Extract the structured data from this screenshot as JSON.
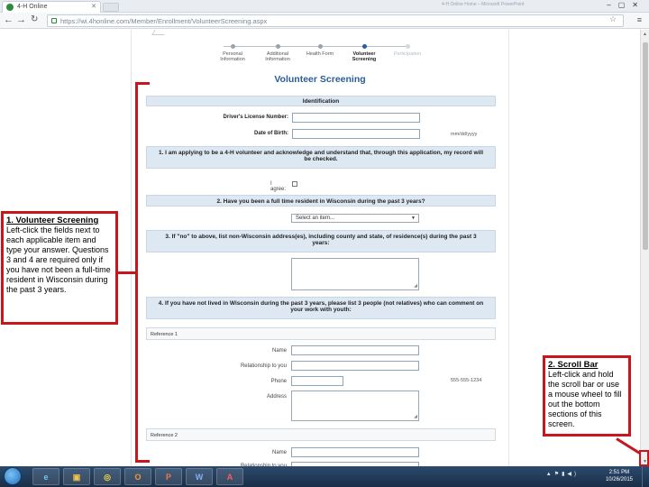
{
  "browser": {
    "tab_title": "4-H Online",
    "tab_ghost_title": "4-H Online Home – Microsoft PowerPoint",
    "url": "https://wi.4honline.com/Member/Enrollment/VolunteerScreening.aspx"
  },
  "wizard": {
    "steps": [
      {
        "label": "Personal Information"
      },
      {
        "label": "Additional Information"
      },
      {
        "label": "Health Form"
      },
      {
        "label": "Volunteer Screening"
      },
      {
        "label": "Participation"
      }
    ]
  },
  "form": {
    "title": "Volunteer Screening",
    "identification": "Identification",
    "drivers_license_label": "Driver's License Number:",
    "dob_label": "Date of Birth:",
    "dob_hint": "mm/dd/yyyy",
    "q1": "1. I am applying to be a 4-H volunteer and acknowledge and understand that, through this application, my record will be checked.",
    "agree_label": "I agree:",
    "q2": "2. Have you been a full time resident in Wisconsin during the past 3 years?",
    "select_placeholder": "Select an item...",
    "q3": "3. If \"no\" to above, list non-Wisconsin address(es), including county and state, of residence(s) during the past 3 years:",
    "q4": "4. If you have not lived in Wisconsin during the past 3 years, please list 3 people (not relatives) who can comment on your work with youth:",
    "reference1": "Reference 1",
    "reference2": "Reference 2",
    "name_label": "Name",
    "relationship_label": "Relationship to you",
    "phone_label": "Phone",
    "phone_hint": "555-555-1234",
    "address_label": "Address"
  },
  "callouts": {
    "screening_title": "1. Volunteer Screening",
    "screening_body": "Left-click the fields next to each applicable item and type your answer. Questions 3 and 4 are required only if you have not been a full-time resident in Wisconsin during the past 3 years.",
    "scroll_title": "2. Scroll Bar",
    "scroll_body": "Left-click and hold the scroll bar or use a mouse wheel to fill out the bottom sections of this screen."
  },
  "taskbar": {
    "apps": [
      {
        "label": "e"
      },
      {
        "label": "▣"
      },
      {
        "label": "◎"
      },
      {
        "label": "O"
      },
      {
        "label": "P"
      },
      {
        "label": "W"
      },
      {
        "label": "A"
      }
    ],
    "time": "2:51 PM",
    "date": "10/26/2015"
  },
  "colors": {
    "annotation_red": "#c8161d",
    "title_blue": "#2b5d96",
    "section_bg": "#dde8f3"
  }
}
